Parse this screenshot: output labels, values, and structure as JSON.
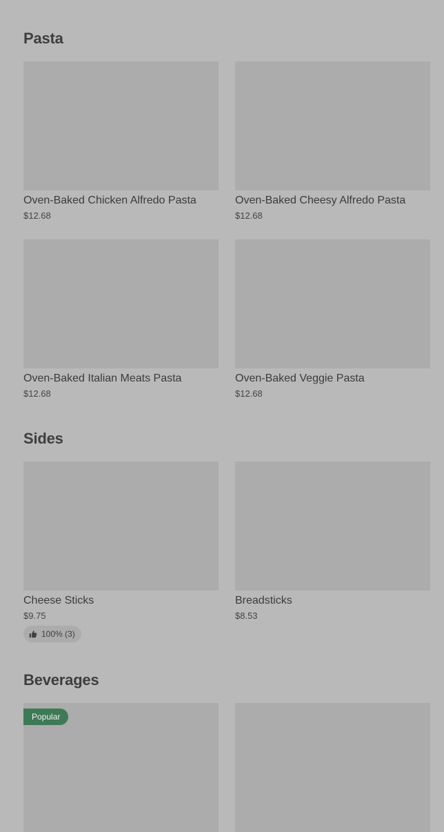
{
  "sections": [
    {
      "title": "Pasta",
      "items": [
        {
          "name": "Oven-Baked Chicken Alfredo Pasta",
          "price": "$12.68"
        },
        {
          "name": "Oven-Baked Cheesy Alfredo Pasta",
          "price": "$12.68"
        },
        {
          "name": "Oven-Baked Italian Meats Pasta",
          "price": "$12.68"
        },
        {
          "name": "Oven-Baked Veggie Pasta",
          "price": "$12.68"
        }
      ]
    },
    {
      "title": "Sides",
      "items": [
        {
          "name": "Cheese Sticks",
          "price": "$9.75",
          "rating": "100% (3)",
          "rating_icon": "thumbs-up-icon"
        },
        {
          "name": "Breadsticks",
          "price": "$8.53"
        }
      ]
    },
    {
      "title": "Beverages",
      "items": [
        {
          "badge": "Popular"
        },
        {}
      ]
    }
  ],
  "colors": {
    "page_background": "#b9b9b9",
    "image_placeholder": "#acacac",
    "popular_badge": "#3d7a55"
  }
}
